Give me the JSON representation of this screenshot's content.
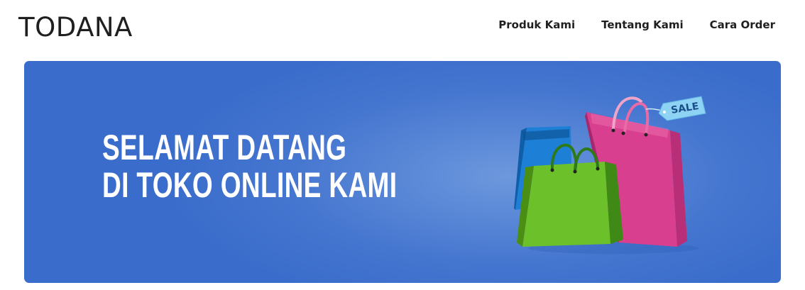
{
  "header": {
    "brand": "TODANA",
    "nav": [
      {
        "label": "Produk Kami"
      },
      {
        "label": "Tentang Kami"
      },
      {
        "label": "Cara Order"
      }
    ]
  },
  "banner": {
    "line1": "SELAMAT DATANG",
    "line2": "DI TOKO ONLINE KAMI",
    "sale_tag": "SALE",
    "colors": {
      "background": "#4475cf",
      "text": "#ffffff",
      "bag_pink": "#d93f8f",
      "bag_green": "#6cc12a",
      "bag_blue": "#1d7fd6",
      "tag": "#8fd3f4"
    },
    "icons": [
      "shopping-bags-illustration",
      "sale-tag-icon"
    ]
  }
}
